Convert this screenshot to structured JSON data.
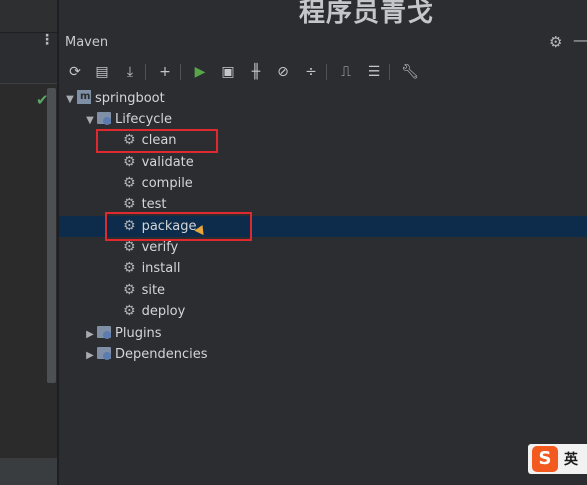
{
  "app": {
    "panel_title": "Maven",
    "watermark": "程序员青戈",
    "ime_label": "英"
  },
  "toolbar": {
    "icons": [
      "reload-icon",
      "add-maven-project-icon",
      "download-sources-icon",
      "add-icon",
      "run-icon",
      "execute-goal-icon",
      "toggle-offline-icon",
      "skip-tests-icon",
      "collapse-icon",
      "analyze-dependencies-icon",
      "show-diagram-icon",
      "settings-wrench-icon"
    ]
  },
  "tree": {
    "project": "springboot",
    "lifecycle": {
      "label": "Lifecycle",
      "goals": [
        "clean",
        "validate",
        "compile",
        "test",
        "package",
        "verify",
        "install",
        "site",
        "deploy"
      ]
    },
    "plugins": "Plugins",
    "dependencies": "Dependencies",
    "selected": "package",
    "highlighted": [
      "clean",
      "package"
    ]
  },
  "colors": {
    "background": "#2b2d30",
    "selection": "#0d2b4a",
    "highlight_box": "#e0292f",
    "run_icon": "#57a64a",
    "text": "#d3d5d9"
  }
}
